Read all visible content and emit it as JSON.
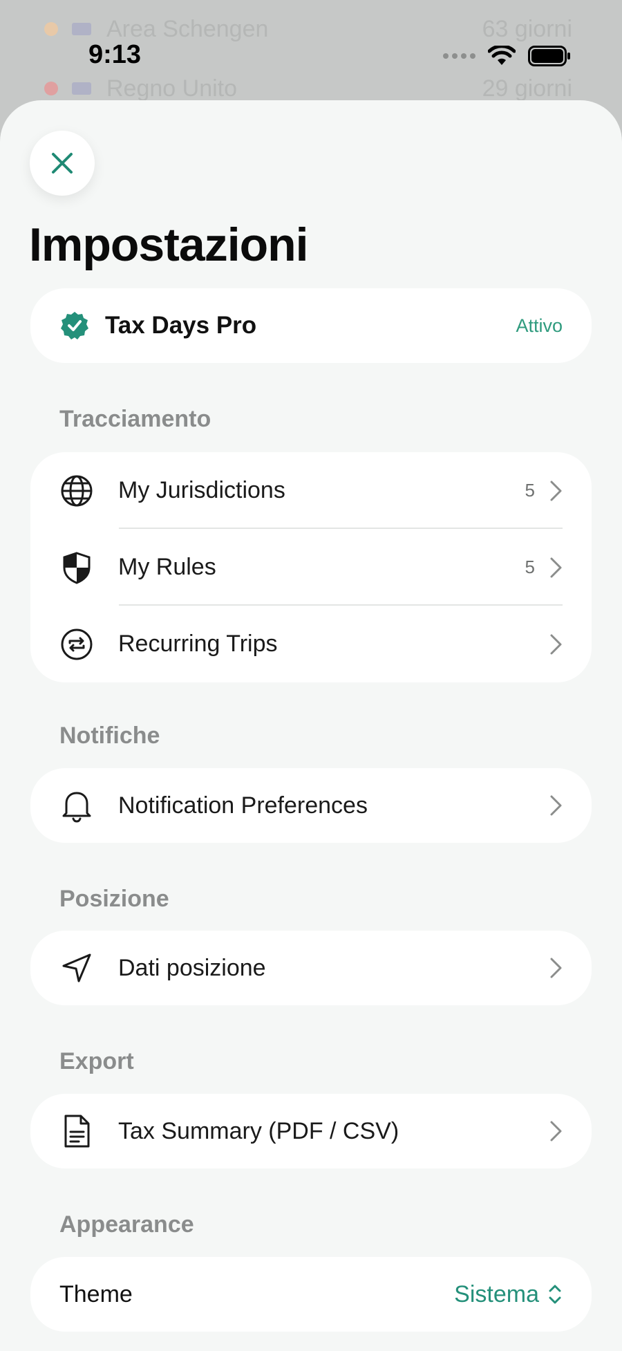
{
  "background": {
    "rows": [
      {
        "label": "Area Schengen",
        "value": "63 giorni",
        "dot_color": "#e8c9a8"
      },
      {
        "label": "Regno Unito",
        "value": "29 giorni",
        "dot_color": "#e0a0a0"
      }
    ]
  },
  "status_bar": {
    "time": "9:13"
  },
  "sheet": {
    "title": "Impostazioni",
    "pro": {
      "name": "Tax Days Pro",
      "status": "Attivo"
    },
    "sections": {
      "tracking": {
        "label": "Tracciamento",
        "items": [
          {
            "label": "My Jurisdictions",
            "count": "5",
            "icon": "globe-icon"
          },
          {
            "label": "My Rules",
            "count": "5",
            "icon": "shield-icon"
          },
          {
            "label": "Recurring Trips",
            "icon": "repeat-icon"
          }
        ]
      },
      "notifications": {
        "label": "Notifiche",
        "items": [
          {
            "label": "Notification Preferences",
            "icon": "bell-icon"
          }
        ]
      },
      "location": {
        "label": "Posizione",
        "items": [
          {
            "label": "Dati posizione",
            "icon": "location-arrow-icon"
          }
        ]
      },
      "export": {
        "label": "Export",
        "items": [
          {
            "label": "Tax Summary (PDF / CSV)",
            "icon": "document-icon"
          }
        ]
      },
      "appearance": {
        "label": "Appearance",
        "theme_label": "Theme",
        "theme_value": "Sistema"
      }
    }
  },
  "colors": {
    "accent": "#24907a",
    "sheet_bg": "#f5f7f6",
    "section_label": "#8a8c8c"
  }
}
